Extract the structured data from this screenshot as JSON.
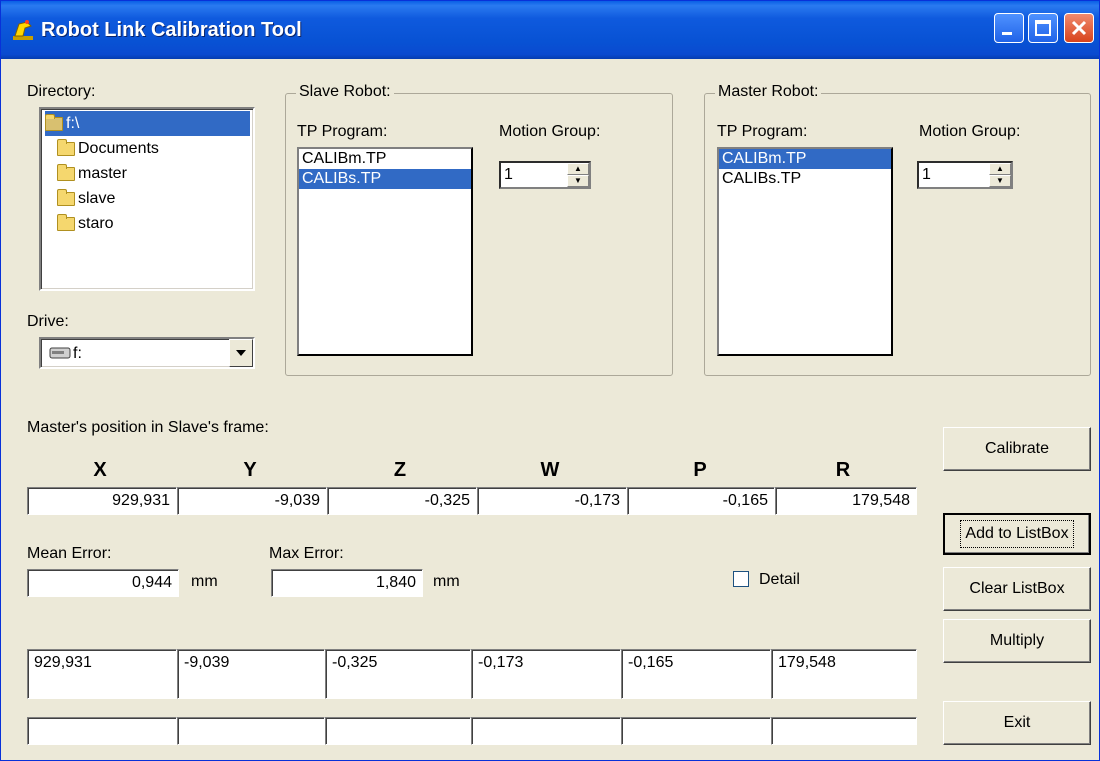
{
  "window": {
    "title": "Robot Link Calibration Tool"
  },
  "directory": {
    "label": "Directory:",
    "items": [
      {
        "name": "f:\\",
        "selected": true
      },
      {
        "name": "Documents"
      },
      {
        "name": "master"
      },
      {
        "name": "slave"
      },
      {
        "name": "staro"
      }
    ]
  },
  "drive": {
    "label": "Drive:",
    "value": "f:"
  },
  "slave": {
    "legend": "Slave Robot:",
    "tp_label": "TP Program:",
    "mg_label": "Motion Group:",
    "programs": [
      "CALIBm.TP",
      "CALIBs.TP"
    ],
    "selected_index": 1,
    "motion_group": "1"
  },
  "master": {
    "legend": "Master Robot:",
    "tp_label": "TP Program:",
    "mg_label": "Motion Group:",
    "programs": [
      "CALIBm.TP",
      "CALIBs.TP"
    ],
    "selected_index": 0,
    "motion_group": "1"
  },
  "position": {
    "label": "Master's position in Slave's frame:",
    "axes": [
      "X",
      "Y",
      "Z",
      "W",
      "P",
      "R"
    ],
    "values": [
      "929,931",
      "-9,039",
      "-0,325",
      "-0,173",
      "-0,165",
      "179,548"
    ]
  },
  "errors": {
    "mean_label": "Mean Error:",
    "mean_value": "0,944",
    "max_label": "Max Error:",
    "max_value": "1,840",
    "unit": "mm"
  },
  "detail": {
    "label": "Detail",
    "checked": false
  },
  "list_row1": [
    "929,931",
    "-9,039",
    "-0,325",
    "-0,173",
    "-0,165",
    "179,548"
  ],
  "list_row2": [
    "",
    "",
    "",
    "",
    "",
    ""
  ],
  "buttons": {
    "calibrate": "Calibrate",
    "add": "Add to ListBox",
    "clear": "Clear ListBox",
    "multiply": "Multiply",
    "exit": "Exit"
  }
}
